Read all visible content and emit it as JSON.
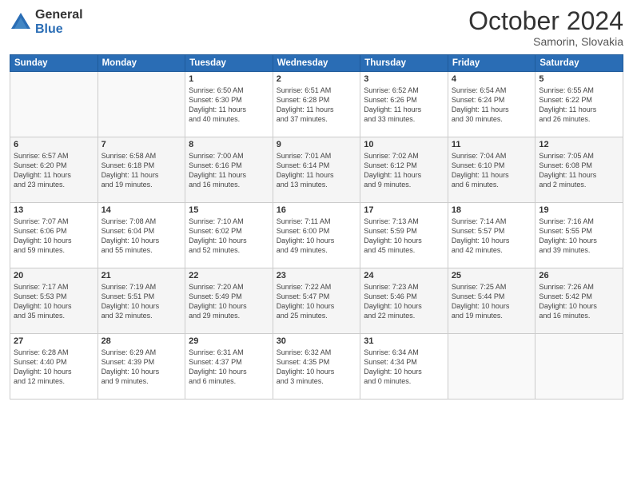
{
  "logo": {
    "general": "General",
    "blue": "Blue"
  },
  "header": {
    "month": "October 2024",
    "location": "Samorin, Slovakia"
  },
  "weekdays": [
    "Sunday",
    "Monday",
    "Tuesday",
    "Wednesday",
    "Thursday",
    "Friday",
    "Saturday"
  ],
  "weeks": [
    [
      {
        "day": "",
        "info": ""
      },
      {
        "day": "",
        "info": ""
      },
      {
        "day": "1",
        "info": "Sunrise: 6:50 AM\nSunset: 6:30 PM\nDaylight: 11 hours\nand 40 minutes."
      },
      {
        "day": "2",
        "info": "Sunrise: 6:51 AM\nSunset: 6:28 PM\nDaylight: 11 hours\nand 37 minutes."
      },
      {
        "day": "3",
        "info": "Sunrise: 6:52 AM\nSunset: 6:26 PM\nDaylight: 11 hours\nand 33 minutes."
      },
      {
        "day": "4",
        "info": "Sunrise: 6:54 AM\nSunset: 6:24 PM\nDaylight: 11 hours\nand 30 minutes."
      },
      {
        "day": "5",
        "info": "Sunrise: 6:55 AM\nSunset: 6:22 PM\nDaylight: 11 hours\nand 26 minutes."
      }
    ],
    [
      {
        "day": "6",
        "info": "Sunrise: 6:57 AM\nSunset: 6:20 PM\nDaylight: 11 hours\nand 23 minutes."
      },
      {
        "day": "7",
        "info": "Sunrise: 6:58 AM\nSunset: 6:18 PM\nDaylight: 11 hours\nand 19 minutes."
      },
      {
        "day": "8",
        "info": "Sunrise: 7:00 AM\nSunset: 6:16 PM\nDaylight: 11 hours\nand 16 minutes."
      },
      {
        "day": "9",
        "info": "Sunrise: 7:01 AM\nSunset: 6:14 PM\nDaylight: 11 hours\nand 13 minutes."
      },
      {
        "day": "10",
        "info": "Sunrise: 7:02 AM\nSunset: 6:12 PM\nDaylight: 11 hours\nand 9 minutes."
      },
      {
        "day": "11",
        "info": "Sunrise: 7:04 AM\nSunset: 6:10 PM\nDaylight: 11 hours\nand 6 minutes."
      },
      {
        "day": "12",
        "info": "Sunrise: 7:05 AM\nSunset: 6:08 PM\nDaylight: 11 hours\nand 2 minutes."
      }
    ],
    [
      {
        "day": "13",
        "info": "Sunrise: 7:07 AM\nSunset: 6:06 PM\nDaylight: 10 hours\nand 59 minutes."
      },
      {
        "day": "14",
        "info": "Sunrise: 7:08 AM\nSunset: 6:04 PM\nDaylight: 10 hours\nand 55 minutes."
      },
      {
        "day": "15",
        "info": "Sunrise: 7:10 AM\nSunset: 6:02 PM\nDaylight: 10 hours\nand 52 minutes."
      },
      {
        "day": "16",
        "info": "Sunrise: 7:11 AM\nSunset: 6:00 PM\nDaylight: 10 hours\nand 49 minutes."
      },
      {
        "day": "17",
        "info": "Sunrise: 7:13 AM\nSunset: 5:59 PM\nDaylight: 10 hours\nand 45 minutes."
      },
      {
        "day": "18",
        "info": "Sunrise: 7:14 AM\nSunset: 5:57 PM\nDaylight: 10 hours\nand 42 minutes."
      },
      {
        "day": "19",
        "info": "Sunrise: 7:16 AM\nSunset: 5:55 PM\nDaylight: 10 hours\nand 39 minutes."
      }
    ],
    [
      {
        "day": "20",
        "info": "Sunrise: 7:17 AM\nSunset: 5:53 PM\nDaylight: 10 hours\nand 35 minutes."
      },
      {
        "day": "21",
        "info": "Sunrise: 7:19 AM\nSunset: 5:51 PM\nDaylight: 10 hours\nand 32 minutes."
      },
      {
        "day": "22",
        "info": "Sunrise: 7:20 AM\nSunset: 5:49 PM\nDaylight: 10 hours\nand 29 minutes."
      },
      {
        "day": "23",
        "info": "Sunrise: 7:22 AM\nSunset: 5:47 PM\nDaylight: 10 hours\nand 25 minutes."
      },
      {
        "day": "24",
        "info": "Sunrise: 7:23 AM\nSunset: 5:46 PM\nDaylight: 10 hours\nand 22 minutes."
      },
      {
        "day": "25",
        "info": "Sunrise: 7:25 AM\nSunset: 5:44 PM\nDaylight: 10 hours\nand 19 minutes."
      },
      {
        "day": "26",
        "info": "Sunrise: 7:26 AM\nSunset: 5:42 PM\nDaylight: 10 hours\nand 16 minutes."
      }
    ],
    [
      {
        "day": "27",
        "info": "Sunrise: 6:28 AM\nSunset: 4:40 PM\nDaylight: 10 hours\nand 12 minutes."
      },
      {
        "day": "28",
        "info": "Sunrise: 6:29 AM\nSunset: 4:39 PM\nDaylight: 10 hours\nand 9 minutes."
      },
      {
        "day": "29",
        "info": "Sunrise: 6:31 AM\nSunset: 4:37 PM\nDaylight: 10 hours\nand 6 minutes."
      },
      {
        "day": "30",
        "info": "Sunrise: 6:32 AM\nSunset: 4:35 PM\nDaylight: 10 hours\nand 3 minutes."
      },
      {
        "day": "31",
        "info": "Sunrise: 6:34 AM\nSunset: 4:34 PM\nDaylight: 10 hours\nand 0 minutes."
      },
      {
        "day": "",
        "info": ""
      },
      {
        "day": "",
        "info": ""
      }
    ]
  ]
}
